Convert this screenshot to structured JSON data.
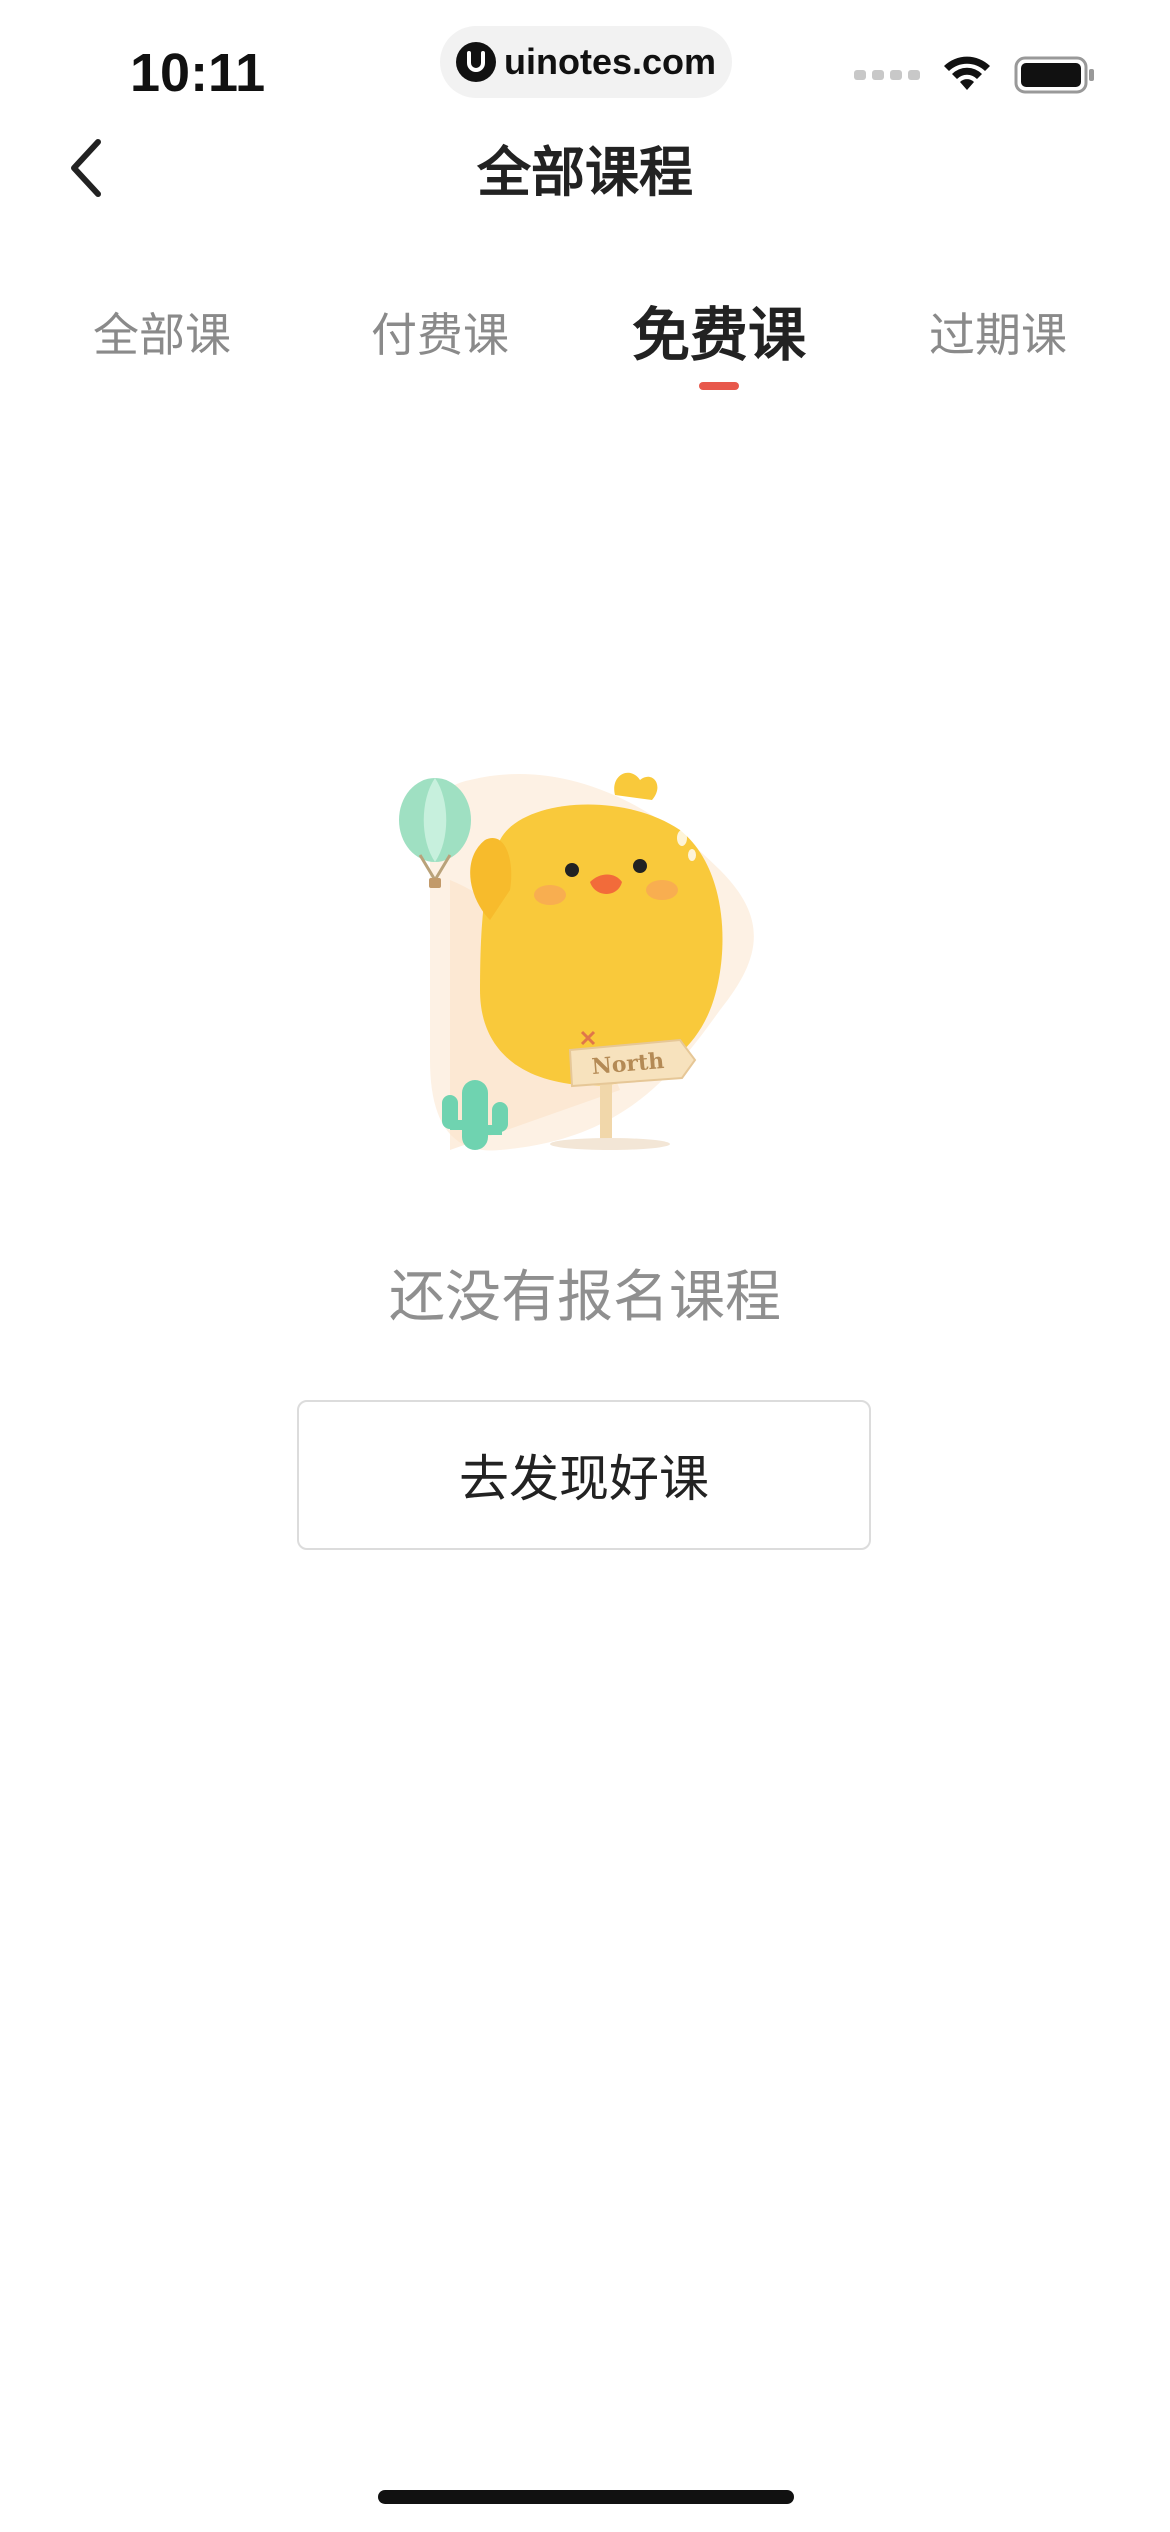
{
  "status_bar": {
    "time": "10:11",
    "url": "uinotes.com"
  },
  "nav": {
    "title": "全部课程"
  },
  "tabs": [
    {
      "label": "全部课",
      "active": false
    },
    {
      "label": "付费课",
      "active": false
    },
    {
      "label": "免费课",
      "active": true
    },
    {
      "label": "过期课",
      "active": false
    }
  ],
  "empty_state": {
    "illustration_sign_text": "North",
    "message": "还没有报名课程",
    "button_label": "去发现好课"
  },
  "colors": {
    "accent": "#e8584b",
    "chick": "#f9c93b",
    "cactus": "#6fd3b0"
  }
}
